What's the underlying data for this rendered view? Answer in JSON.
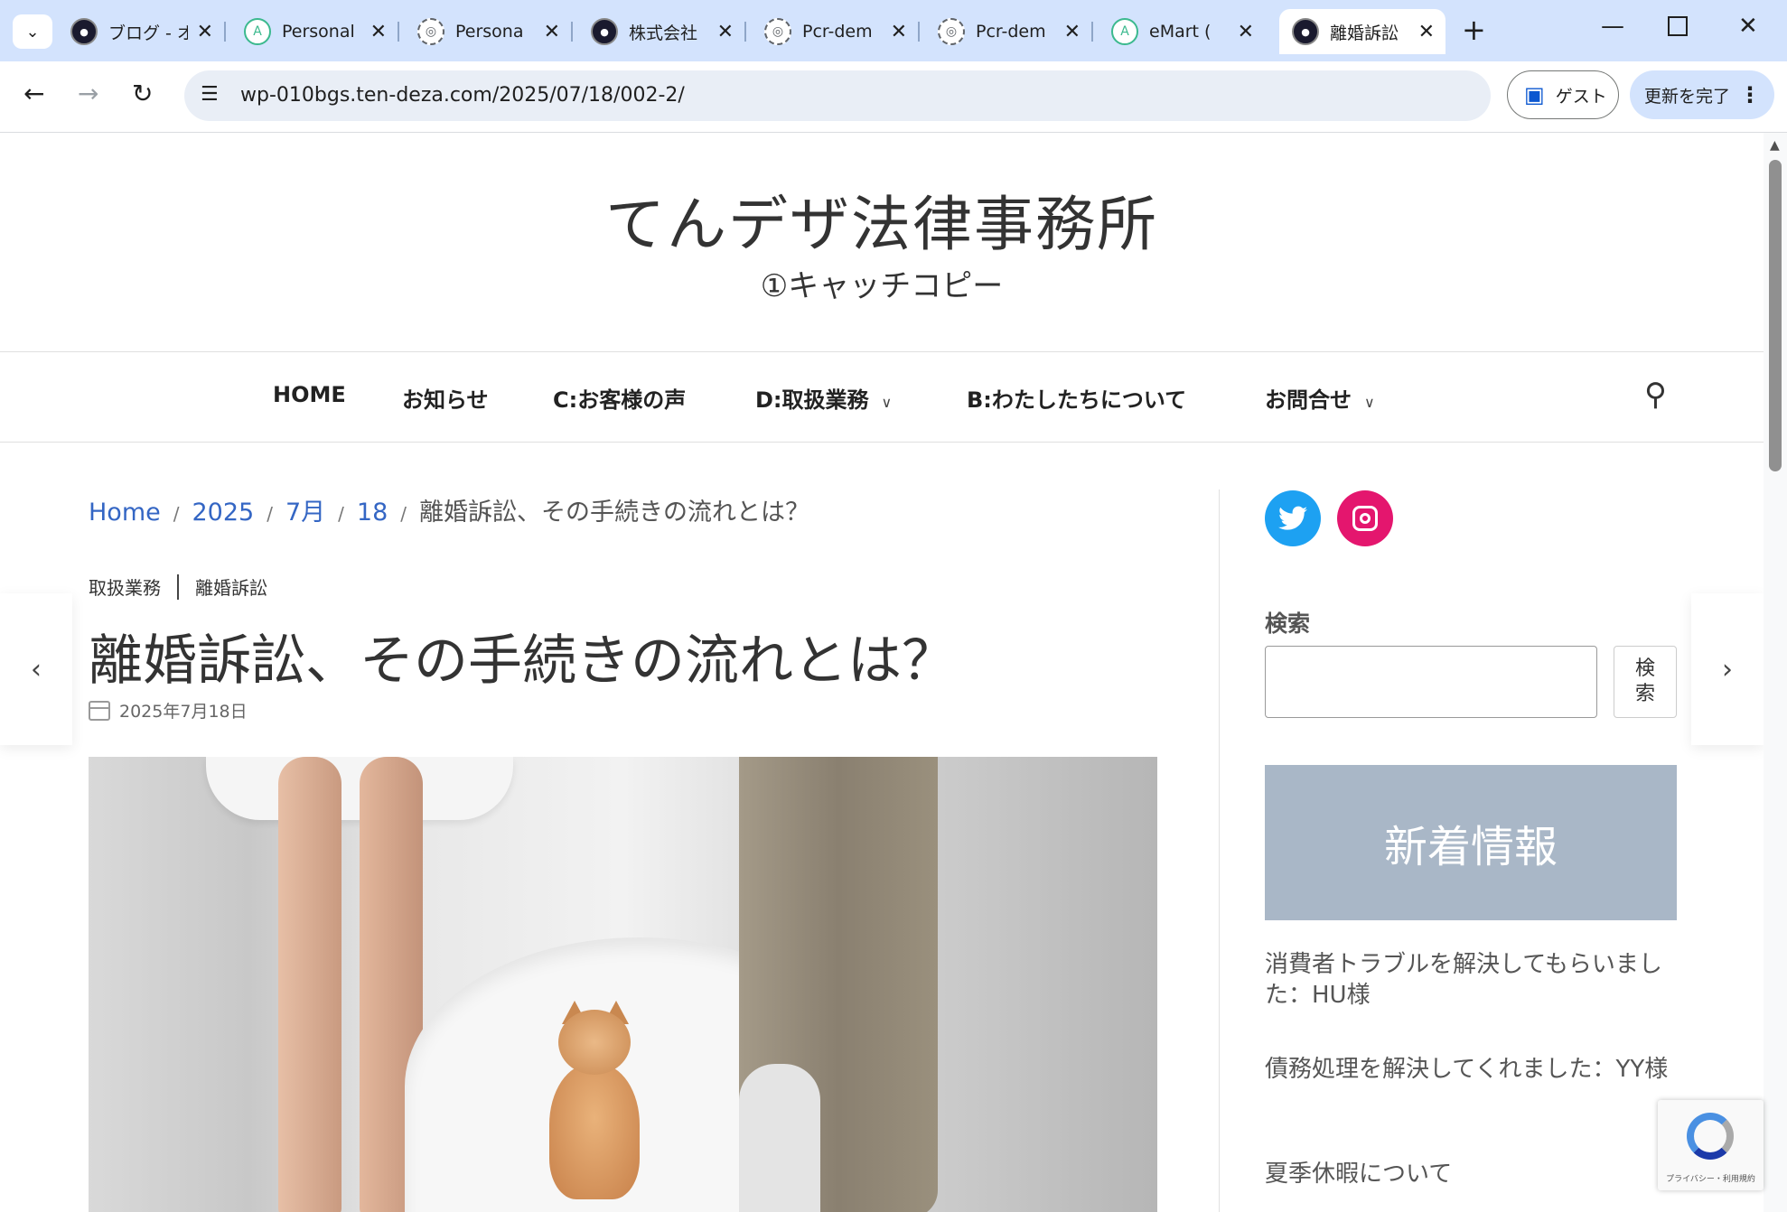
{
  "browser": {
    "tabs": [
      {
        "label": "ブログ - オ",
        "favicon": "dark"
      },
      {
        "label": "Personal",
        "favicon": "green"
      },
      {
        "label": "Persona",
        "favicon": "globe"
      },
      {
        "label": "株式会社",
        "favicon": "dark"
      },
      {
        "label": "Pcr-dem",
        "favicon": "globe"
      },
      {
        "label": "Pcr-dem",
        "favicon": "globe"
      },
      {
        "label": "eMart (",
        "favicon": "green"
      },
      {
        "label": "離婚訴訟",
        "favicon": "dark",
        "active": true
      }
    ],
    "new_tab": "+",
    "url": "wp-010bgs.ten-deza.com/2025/07/18/002-2/",
    "guest_label": "ゲスト",
    "update_label": "更新を完了"
  },
  "site": {
    "title": "てんデザ法律事務所",
    "tagline": "①キャッチコピー",
    "menu": [
      {
        "label": "HOME",
        "has_submenu": false
      },
      {
        "label": "お知らせ",
        "has_submenu": false
      },
      {
        "label": "C:お客様の声",
        "has_submenu": false
      },
      {
        "label": "D:取扱業務",
        "has_submenu": true
      },
      {
        "label": "B:わたしたちについて",
        "has_submenu": false
      },
      {
        "label": "お問合せ",
        "has_submenu": true
      }
    ]
  },
  "breadcrumb": {
    "items": [
      "Home",
      "2025",
      "7月",
      "18"
    ],
    "current": "離婚訴訟、その手続きの流れとは？"
  },
  "post": {
    "categories": [
      "取扱業務",
      "離婚訴訟"
    ],
    "title": "離婚訴訟、その手続きの流れとは？",
    "date": "2025年7月18日"
  },
  "sidebar": {
    "search_label": "検索",
    "search_button": "検\n索",
    "news_banner": "新着情報",
    "news": [
      "消費者トラブルを解決してもらいました：HU様",
      "債務処理を解決してくれました：YY様",
      "夏季休暇について"
    ]
  },
  "recaptcha": {
    "text": "プライバシー・利用規約"
  },
  "colors": {
    "tabbar": "#d3e3fd",
    "link": "#3466c4",
    "twitter": "#1da1f2",
    "instagram": "#e4166e",
    "news_banner": "#a9b7c7"
  }
}
